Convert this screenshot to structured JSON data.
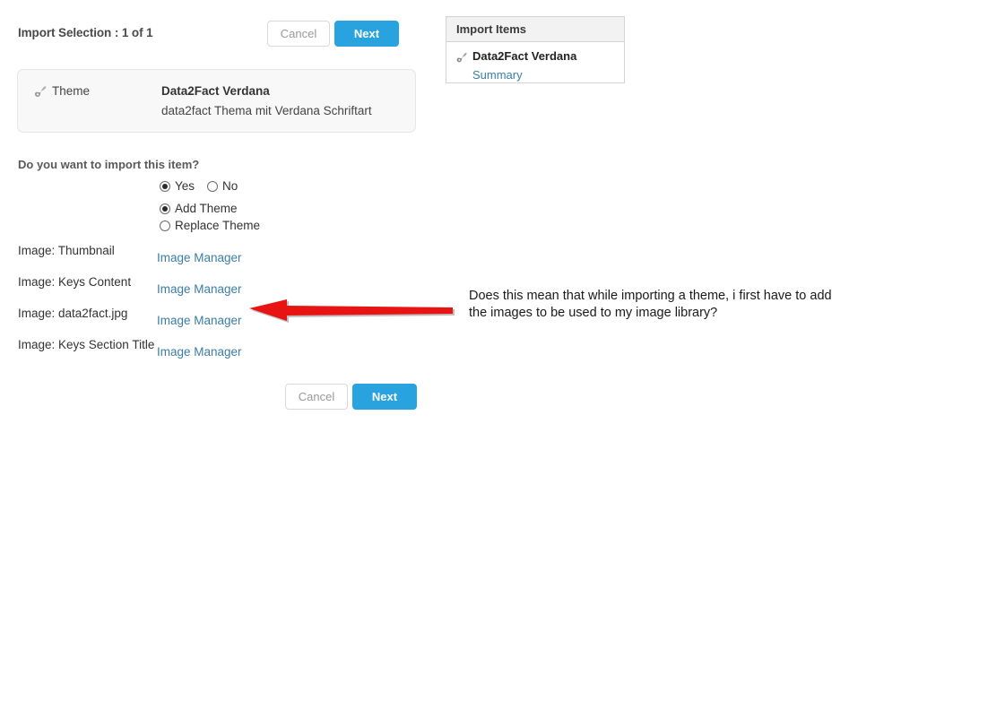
{
  "header": {
    "title": "Import Selection : 1 of 1",
    "cancel_label": "Cancel",
    "next_label": "Next"
  },
  "theme_card": {
    "icon": "theme-brush-icon",
    "type_label": "Theme",
    "name": "Data2Fact Verdana",
    "description": "data2fact Thema mit Verdana Schriftart"
  },
  "form": {
    "question": "Do you want to import this item?",
    "import_choice": {
      "options": [
        {
          "label": "Yes",
          "checked": true
        },
        {
          "label": "No",
          "checked": false
        }
      ]
    },
    "theme_action": {
      "options": [
        {
          "label": "Add Theme",
          "checked": true
        },
        {
          "label": "Replace Theme",
          "checked": false
        }
      ]
    },
    "image_rows": [
      {
        "label": "Image: Thumbnail",
        "link": "Image Manager"
      },
      {
        "label": "Image: Keys Content",
        "link": "Image Manager"
      },
      {
        "label": "Image: data2fact.jpg",
        "link": "Image Manager"
      },
      {
        "label": "Image: Keys Section Title",
        "link": "Image Manager"
      }
    ]
  },
  "footer": {
    "cancel_label": "Cancel",
    "next_label": "Next"
  },
  "import_items_panel": {
    "header": "Import Items",
    "entry_icon": "theme-brush-icon",
    "entry_name": "Data2Fact Verdana",
    "summary_link": "Summary"
  },
  "annotation": {
    "text": "Does this mean that while importing a theme, i first have to add the images to be used to my image library?",
    "arrow": "left-pointing-arrow",
    "arrow_color": "#e81414"
  },
  "colors": {
    "primary_button": "#29a3e0",
    "link": "#3b7ea5",
    "card_background": "#f8f8f8",
    "panel_header": "#f2f2f2"
  }
}
